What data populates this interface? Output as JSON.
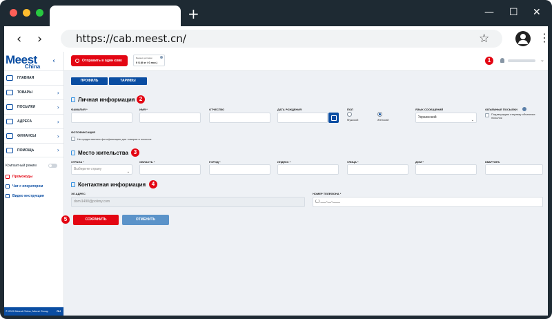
{
  "browser": {
    "url": "https://cab.meest.cn/",
    "colors": {
      "chrome": "#1e2a33",
      "close": "#ff5f57",
      "minimize": "#febc2e",
      "maximize": "#28c840"
    }
  },
  "sidebar": {
    "logo": "Meest",
    "logo_sub": "China",
    "items": [
      {
        "label": "ГЛАВНАЯ",
        "icon": "home-icon"
      },
      {
        "label": "ТОВАРЫ",
        "icon": "cart-icon"
      },
      {
        "label": "ПОСЫЛКИ",
        "icon": "package-icon"
      },
      {
        "label": "АДРЕСА",
        "icon": "location-icon"
      },
      {
        "label": "ФИНАНСЫ",
        "icon": "wallet-icon"
      },
      {
        "label": "ПОМОЩЬ",
        "icon": "help-icon"
      }
    ],
    "compact_mode": "Компактный режим",
    "promo": "Промокоды",
    "chat": "Чат с оператором",
    "video": "Видео инструкция",
    "footer": "© 2020 Meest China, Meest Group",
    "lang": "RU"
  },
  "topbar": {
    "send_button": "Отправить в один клик",
    "balance_title": "Баланс доставки",
    "balance_value": "0 $ (0 кг / 0 лок.)"
  },
  "tabs": {
    "profile": "ПРОФИЛЬ",
    "tariffs": "ТАРИФЫ"
  },
  "personal": {
    "title": "Личная информация",
    "surname": "ФАМИЛИЯ *",
    "name": "ИМЯ *",
    "patronymic": "ОТЧЕСТВО",
    "birthdate": "ДАТА РОЖДЕНИЯ",
    "gender": "ПОЛ",
    "male": "Мужской",
    "female": "Женский",
    "lang_label": "ЯЗЫК СООБЩЕНИЙ",
    "lang_value": "Украинский",
    "bulky_label": "ОБЪЕМНЫЕ ПОСЫЛКИ",
    "bulky_confirm": "Подтверждаю отправку объемных посылок",
    "photo_label": "ФОТОФИКСАЦИЯ",
    "photo_option": "Не предоставлять фотофиксацию для товаров и посылок"
  },
  "residence": {
    "title": "Место жительства",
    "country": "СТРАНА *",
    "country_placeholder": "Выберите страну",
    "region": "ОБЛАСТЬ *",
    "city": "ГОРОД *",
    "index": "ИНДЕКС *",
    "street": "УЛИЦА *",
    "house": "ДОМ *",
    "flat": "КВАРТИРА"
  },
  "contact": {
    "title": "Контактная информация",
    "email_label": "ЭЛ.АДРЕС",
    "email_value": "domi1490@potimy.com",
    "phone_label": "НОМЕР ТЕЛЕФОНА *",
    "phone_placeholder": "(_) ___-__-____"
  },
  "buttons": {
    "save": "СОХРАНИТЬ",
    "cancel": "ОТМЕНИТЬ"
  },
  "steps": {
    "s1": "1",
    "s2": "2",
    "s3": "3",
    "s4": "4",
    "s5": "5"
  },
  "colors": {
    "brand_blue": "#0a4da2",
    "brand_red": "#e30613",
    "cancel_blue": "#5b93c9"
  }
}
